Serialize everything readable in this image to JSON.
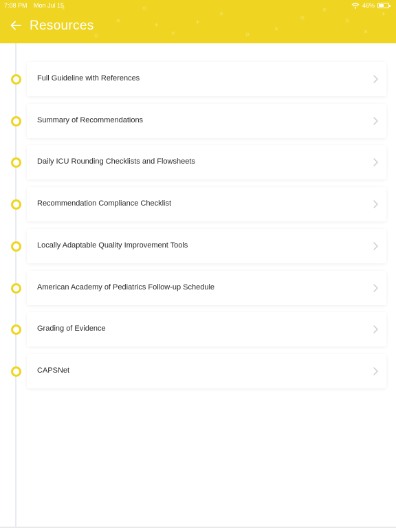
{
  "status_bar": {
    "time": "7:08 PM",
    "date": "Mon Jul 15",
    "battery": "46%",
    "battery_level": 0.46,
    "icons": [
      "wifi-icon",
      "battery-icon"
    ]
  },
  "header": {
    "title": "Resources",
    "back_icon": "arrow-left-icon"
  },
  "colors": {
    "accent": "#efd522",
    "timeline": "#e8ebf1",
    "card_text": "#2a2a2a",
    "chevron": "#c7c7cc"
  },
  "resources": [
    {
      "label": "Full Guideline with References"
    },
    {
      "label": "Summary of Recommendations"
    },
    {
      "label": "Daily ICU Rounding Checklists and Flowsheets"
    },
    {
      "label": "Recommendation Compliance Checklist"
    },
    {
      "label": "Locally Adaptable Quality Improvement Tools"
    },
    {
      "label": "American Academy of Pediatrics Follow-up Schedule"
    },
    {
      "label": "Grading of Evidence"
    },
    {
      "label": "CAPSNet"
    }
  ]
}
